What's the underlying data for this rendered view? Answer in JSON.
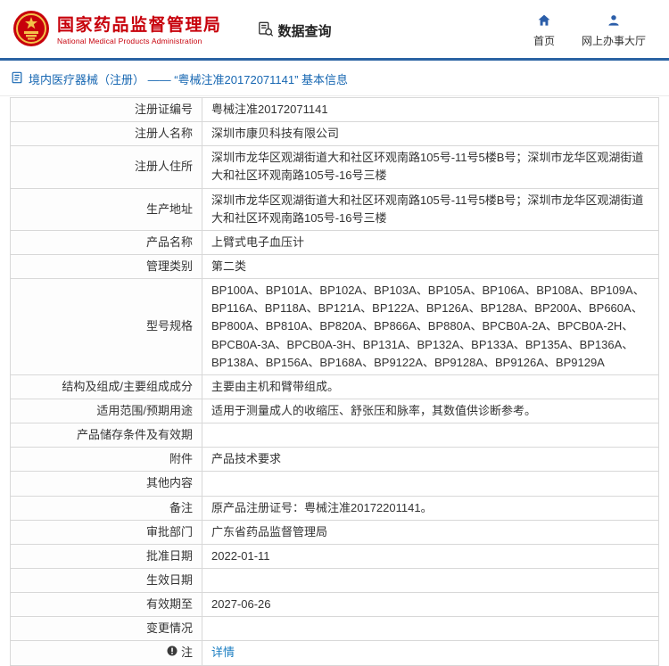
{
  "header": {
    "org_name_cn": "国家药品监督管理局",
    "org_name_en": "National Medical Products Administration",
    "data_query_label": "数据查询",
    "nav": [
      {
        "label": "首页"
      },
      {
        "label": "网上办事大厅"
      }
    ],
    "colors": {
      "brand_red": "#c7000b",
      "nav_blue": "#2b5ea9",
      "divider_blue": "#2b63a3"
    }
  },
  "breadcrumb": {
    "text": "境内医疗器械（注册） —— “粤械注准20172071141” 基本信息"
  },
  "table": {
    "rows": [
      {
        "label": "注册证编号",
        "value": "粤械注准20172071141"
      },
      {
        "label": "注册人名称",
        "value": "深圳市康贝科技有限公司"
      },
      {
        "label": "注册人住所",
        "value": "深圳市龙华区观湖街道大和社区环观南路105号-11号5楼B号；深圳市龙华区观湖街道大和社区环观南路105号-16号三楼"
      },
      {
        "label": "生产地址",
        "value": "深圳市龙华区观湖街道大和社区环观南路105号-11号5楼B号；深圳市龙华区观湖街道大和社区环观南路105号-16号三楼"
      },
      {
        "label": "产品名称",
        "value": "上臂式电子血压计"
      },
      {
        "label": "管理类别",
        "value": "第二类"
      },
      {
        "label": "型号规格",
        "value": "BP100A、BP101A、BP102A、BP103A、BP105A、BP106A、BP108A、BP109A、BP116A、BP118A、BP121A、BP122A、BP126A、BP128A、BP200A、BP660A、BP800A、BP810A、BP820A、BP866A、BP880A、BPCB0A-2A、BPCB0A-2H、BPCB0A-3A、BPCB0A-3H、BP131A、BP132A、BP133A、BP135A、BP136A、BP138A、BP156A、BP168A、BP9122A、BP9128A、BP9126A、BP9129A"
      },
      {
        "label": "结构及组成/主要组成成分",
        "value": "主要由主机和臂带组成。"
      },
      {
        "label": "适用范围/预期用途",
        "value": "适用于测量成人的收缩压、舒张压和脉率，其数值供诊断参考。"
      },
      {
        "label": "产品储存条件及有效期",
        "value": ""
      },
      {
        "label": "附件",
        "value": "产品技术要求"
      },
      {
        "label": "其他内容",
        "value": ""
      },
      {
        "label": "备注",
        "value": "原产品注册证号：粤械注准20172201141。"
      },
      {
        "label": "审批部门",
        "value": "广东省药品监督管理局"
      },
      {
        "label": "批准日期",
        "value": "2022-01-11"
      },
      {
        "label": "生效日期",
        "value": ""
      },
      {
        "label": "有效期至",
        "value": "2027-06-26"
      },
      {
        "label": "变更情况",
        "value": ""
      },
      {
        "label": "注",
        "value": "详情"
      }
    ]
  }
}
